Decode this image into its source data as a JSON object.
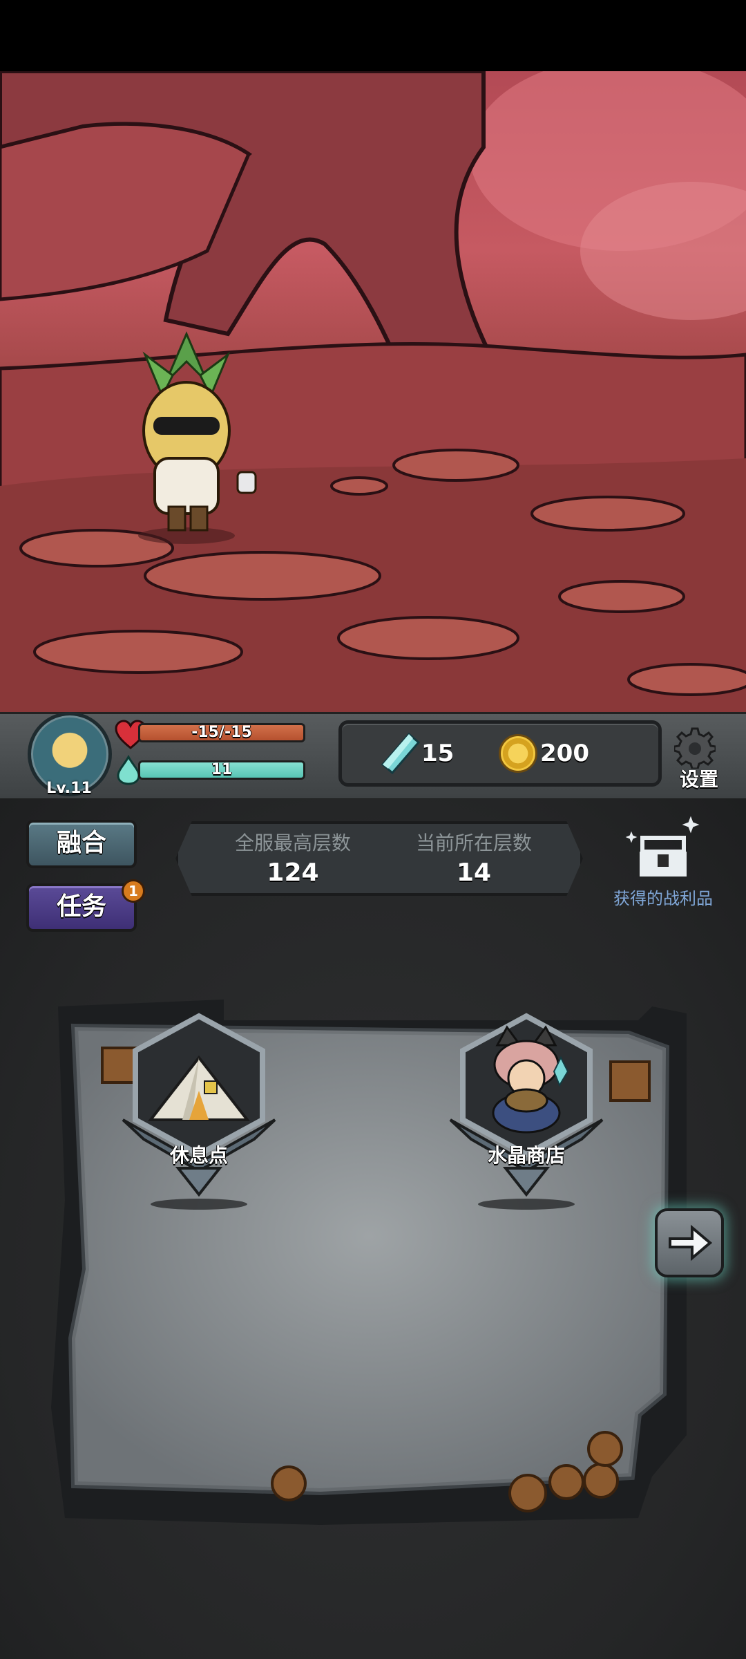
{
  "player": {
    "level": "Lv.11",
    "hp": "-15/-15",
    "mp": "11"
  },
  "currency": {
    "crystals": "15",
    "gold": "200"
  },
  "settings_label": "设置",
  "buttons": {
    "fuse": "融合",
    "tasks": "任务",
    "task_badge": "1"
  },
  "floors": {
    "server_max_label": "全服最高层数",
    "server_max_value": "124",
    "current_label": "当前所在层数",
    "current_value": "14"
  },
  "loot_label": "获得的战利品",
  "nodes": {
    "rest": "休息点",
    "shop": "水晶商店"
  },
  "icons": [
    "heart-icon",
    "mana-drop-icon",
    "crystal-icon",
    "gold-coin-icon",
    "gear-icon",
    "treasure-chest-icon",
    "tent-icon",
    "arrow-right-icon"
  ]
}
